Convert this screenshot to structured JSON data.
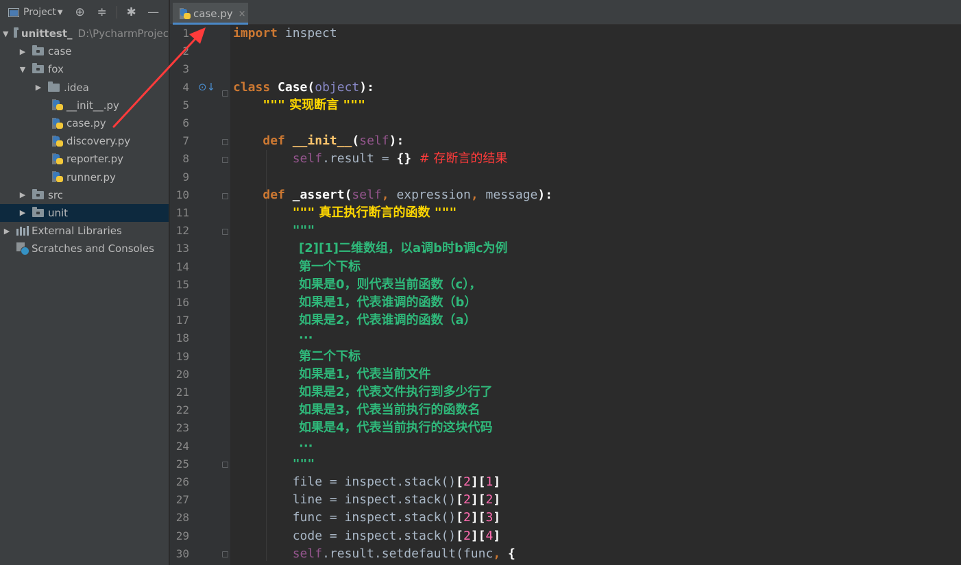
{
  "sidebar": {
    "title": "Project",
    "tree": [
      {
        "label": "unittest_",
        "path": "D:\\PycharmProjec",
        "icon": "folder-icon",
        "level": 0,
        "expanded": true
      },
      {
        "label": "case",
        "icon": "folder-icon",
        "level": 1,
        "expanded": false
      },
      {
        "label": "fox",
        "icon": "folder-icon",
        "level": 1,
        "expanded": true
      },
      {
        "label": ".idea",
        "icon": "folder-icon",
        "level": 2,
        "expanded": false
      },
      {
        "label": "__init__.py",
        "icon": "python-file-icon",
        "level": 3
      },
      {
        "label": "case.py",
        "icon": "python-file-icon",
        "level": 3
      },
      {
        "label": "discovery.py",
        "icon": "python-file-icon",
        "level": 3
      },
      {
        "label": "reporter.py",
        "icon": "python-file-icon",
        "level": 3
      },
      {
        "label": "runner.py",
        "icon": "python-file-icon",
        "level": 3
      },
      {
        "label": "src",
        "icon": "folder-icon",
        "level": 1,
        "expanded": false
      },
      {
        "label": "unit",
        "icon": "folder-icon",
        "level": 1,
        "expanded": false,
        "selected": true
      },
      {
        "label": "External Libraries",
        "icon": "library-icon",
        "level": 0,
        "expanded": false
      },
      {
        "label": "Scratches and Consoles",
        "icon": "scratch-icon",
        "level": 0
      }
    ]
  },
  "editor": {
    "tab_label": "case.py",
    "tab_close": "×",
    "line_numbers": [
      "1",
      "2",
      "3",
      "4",
      "5",
      "6",
      "7",
      "8",
      "9",
      "10",
      "11",
      "12",
      "13",
      "14",
      "15",
      "16",
      "17",
      "18",
      "19",
      "20",
      "21",
      "22",
      "23",
      "24",
      "25",
      "26",
      "27",
      "28",
      "29",
      "30"
    ],
    "code": {
      "l1_kw": "import",
      "l1_rest": " inspect",
      "l4_kw": "class",
      "l4_name": "Case",
      "l4_paren_open": "(",
      "l4_base": "object",
      "l4_paren_close": "):",
      "l5_q1": "\"\"\"",
      "l5_text": " 实现断言 ",
      "l5_q2": "\"\"\"",
      "l7_kw": "def",
      "l7_name": "__init__",
      "l7_open": "(",
      "l7_self": "self",
      "l7_close": "):",
      "l8_self": "self",
      "l8_rest": ".result = ",
      "l8_braces": "{}",
      "l8_comment": "  # 存断言的结果",
      "l10_kw": "def",
      "l10_name": "_assert",
      "l10_open": "(",
      "l10_self": "self",
      "l10_sep1": ", ",
      "l10_arg1": "expression",
      "l10_sep2": ", ",
      "l10_arg2": "message",
      "l10_close": "):",
      "l11_q1": "\"\"\"",
      "l11_text": " 真正执行断言的函数 ",
      "l11_q2": "\"\"\"",
      "l12": "\"\"\"",
      "l13": "[2][1]二维数组，以a调b时b调c为例",
      "l14": "第一个下标",
      "l15": "如果是0，则代表当前函数（c），",
      "l16": "如果是1，代表谁调的函数（b）",
      "l17": "如果是2，代表谁调的函数（a）",
      "l18": "···",
      "l19": "第二个下标",
      "l20": "如果是1，代表当前文件",
      "l21": "如果是2，代表文件执行到多少行了",
      "l22": "如果是3，代表当前执行的函数名",
      "l23": "如果是4，代表当前执行的这块代码",
      "l24": "···",
      "l25": "\"\"\"",
      "l26_var": "file",
      "l27_var": "line",
      "l28_var": "func",
      "l29_var": "code",
      "assign": " = ",
      "call": "inspect.stack()",
      "br_open": "[",
      "br_close": "]",
      "idx_2": "2",
      "l26_idx": "1",
      "l27_idx": "2",
      "l28_idx": "3",
      "l29_idx": "4",
      "l30_self": "self",
      "l30_call": ".result.setdefault(func",
      "l30_sep": ", ",
      "l30_brace": "{"
    }
  },
  "colors": {
    "annotation_arrow": "#ff3b3b",
    "tab_underline": "#4a88c7",
    "selection": "#0d293e"
  }
}
